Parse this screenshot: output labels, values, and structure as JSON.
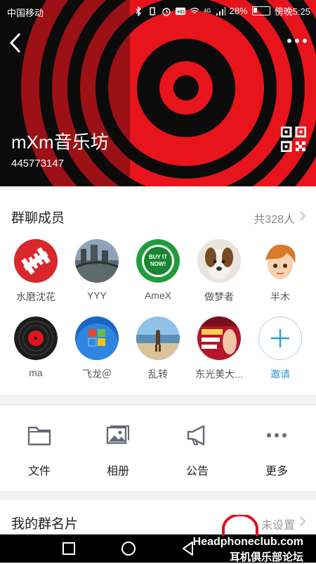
{
  "status_bar": {
    "carrier": "中国移动",
    "battery": "28%",
    "time": "傍晚5:25",
    "network": "4G"
  },
  "group": {
    "name": "mXm音乐坊",
    "id": "445773147"
  },
  "members_section": {
    "title": "群聊成员",
    "count": "共328人",
    "members": [
      {
        "name": "水磨沈花"
      },
      {
        "name": "YYY"
      },
      {
        "name": "AmeX"
      },
      {
        "name": "做梦者"
      },
      {
        "name": "半木"
      },
      {
        "name": "ma"
      },
      {
        "name": "飞龙＠"
      },
      {
        "name": "乱转"
      },
      {
        "name": "东光美大..."
      }
    ],
    "invite_label": "邀请",
    "badge_text": "BUY IT NOW!"
  },
  "actions": [
    {
      "label": "文件",
      "icon": "folder-icon"
    },
    {
      "label": "相册",
      "icon": "album-icon"
    },
    {
      "label": "公告",
      "icon": "megaphone-icon"
    },
    {
      "label": "更多",
      "icon": "more-icon"
    }
  ],
  "my_card": {
    "label": "我的群名片",
    "value": "未设置"
  },
  "watermark": {
    "line1": "Headphoneclub.com",
    "line2": "耳机俱乐部论坛"
  },
  "colors": {
    "header_red": "#e8141b",
    "accent_blue": "#2a9ad6",
    "icon_gray": "#666a73"
  }
}
